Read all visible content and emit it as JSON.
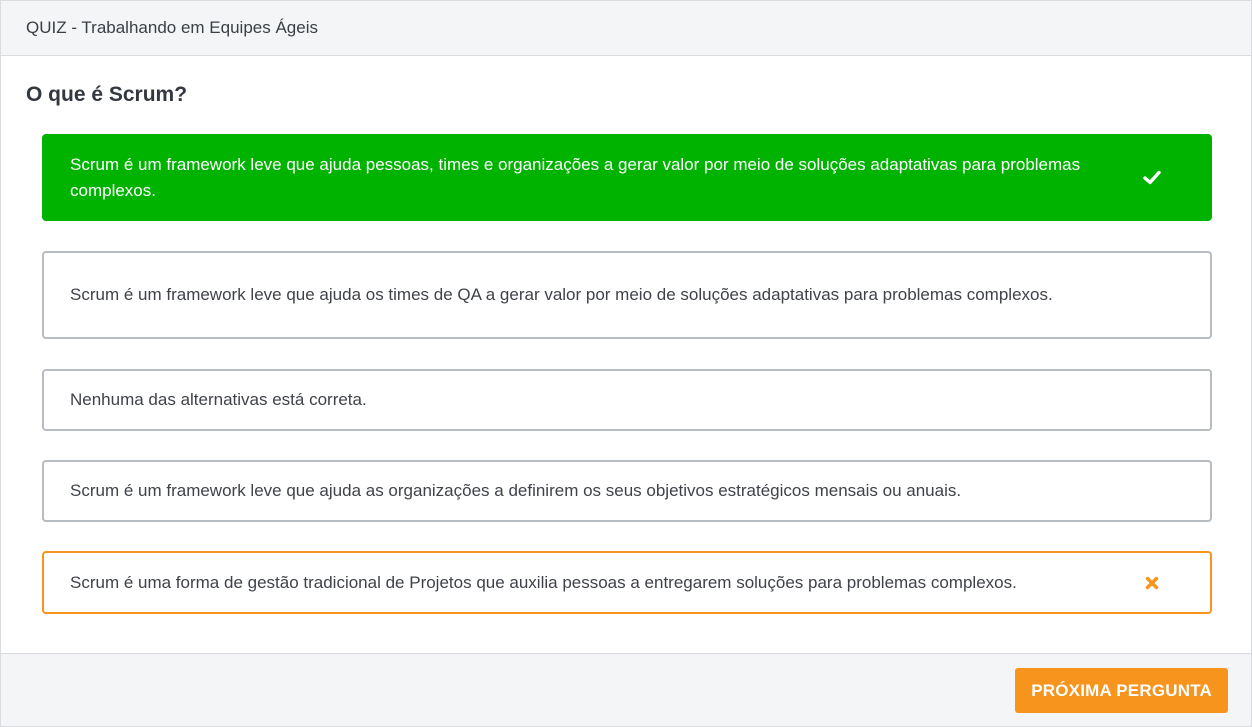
{
  "header": {
    "title": "QUIZ - Trabalhando em Equipes Ágeis"
  },
  "question": {
    "text": "O que é Scrum?"
  },
  "options": [
    {
      "text": "Scrum é um framework leve que ajuda pessoas, times e organizações a gerar valor por meio de soluções adaptativas para problemas complexos.",
      "state": "correct",
      "icon": "check-icon"
    },
    {
      "text": "Scrum é um framework leve que ajuda os times de QA a gerar valor por meio de soluções adaptativas para problemas complexos.",
      "state": "neutral"
    },
    {
      "text": "Nenhuma das alternativas está correta.",
      "state": "neutral"
    },
    {
      "text": "Scrum é um framework leve que ajuda as organizações a definirem os seus objetivos estratégicos mensais ou anuais.",
      "state": "neutral"
    },
    {
      "text": "Scrum é uma forma de gestão tradicional de Projetos que auxilia pessoas a entregarem soluções para problemas complexos.",
      "state": "wrong",
      "icon": "x-icon"
    }
  ],
  "footer": {
    "next_label": "PRÓXIMA PERGUNTA"
  },
  "colors": {
    "correct": "#00b300",
    "wrong": "#f7941d",
    "accent": "#f7941d",
    "neutral_border": "#b7bcc2"
  }
}
